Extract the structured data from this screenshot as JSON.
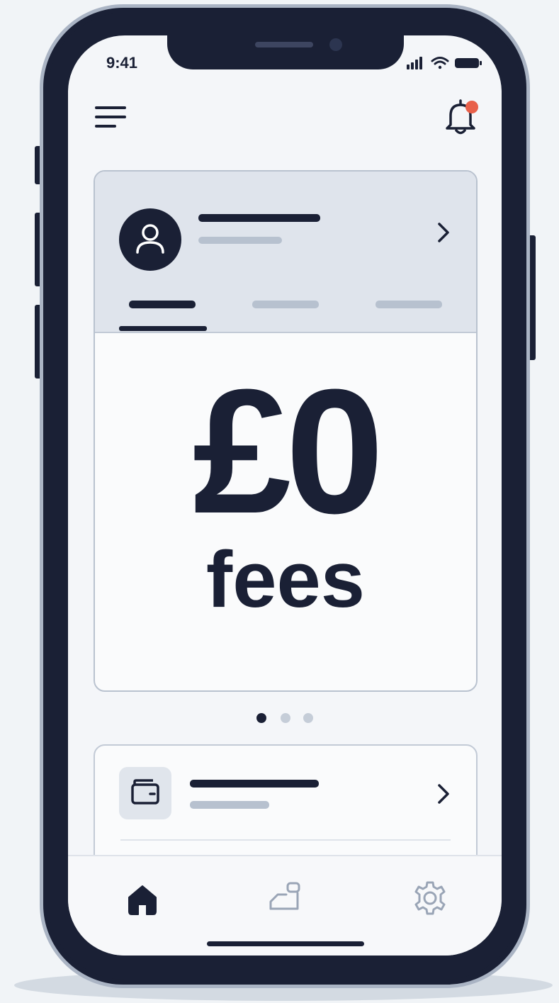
{
  "status_bar": {
    "time": "9:41",
    "icons": [
      "signal-icon",
      "wifi-icon",
      "battery-icon"
    ]
  },
  "header": {
    "menu_icon": "hamburger-menu-icon",
    "notification_icon": "bell-icon",
    "notification_badge_color": "#e8604a"
  },
  "hero_card": {
    "avatar_icon": "user-icon",
    "amount": "£0",
    "caption": "fees",
    "tab_count": 3,
    "active_tab_index": 0,
    "chevron_icon": "chevron-right-icon"
  },
  "carousel": {
    "page_count": 3,
    "active_index": 0
  },
  "list_card": {
    "icon": "wallet-icon",
    "chevron_icon": "chevron-right-icon"
  },
  "bottom_nav": {
    "items": [
      {
        "icon": "home-icon",
        "active": true
      },
      {
        "icon": "transfer-icon",
        "active": false
      },
      {
        "icon": "gear-icon",
        "active": false
      }
    ]
  },
  "colors": {
    "ink": "#1a2035",
    "muted": "#b7c1cf",
    "header_bg": "#dfe4ec",
    "accent_badge": "#e8604a"
  }
}
